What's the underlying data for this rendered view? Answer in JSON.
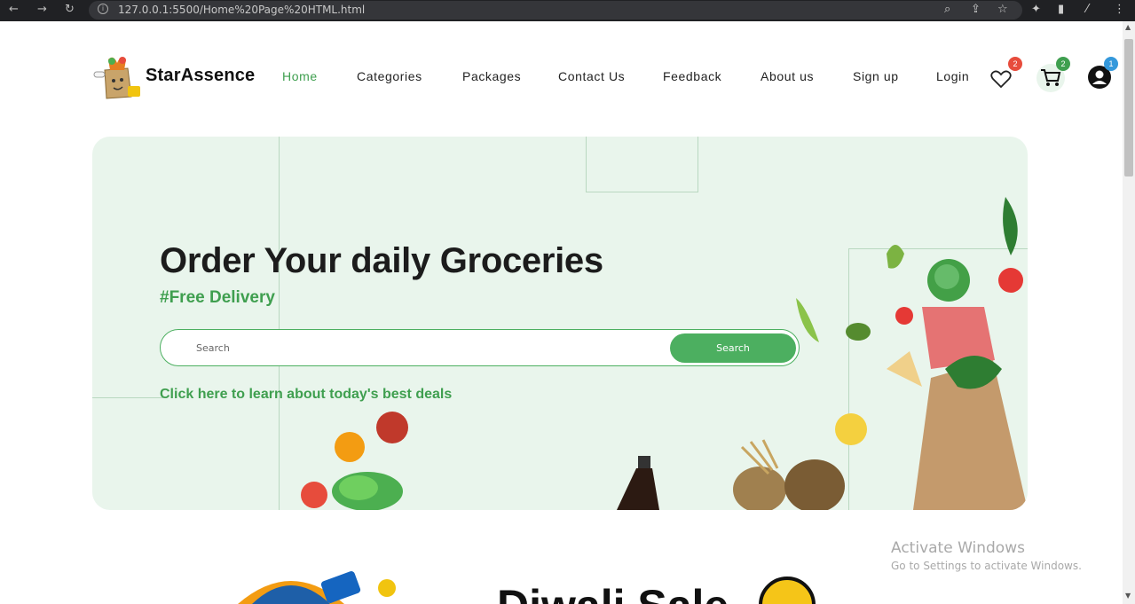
{
  "browser": {
    "url": "127.0.0.1:5500/Home%20Page%20HTML.html"
  },
  "header": {
    "brand": "StarAssence",
    "nav": [
      {
        "label": "Home",
        "active": true
      },
      {
        "label": "Categories",
        "active": false
      },
      {
        "label": "Packages",
        "active": false
      },
      {
        "label": "Contact Us",
        "active": false
      },
      {
        "label": "Feedback",
        "active": false
      },
      {
        "label": "About us",
        "active": false
      },
      {
        "label": "Sign up",
        "active": false
      },
      {
        "label": "Login",
        "active": false
      }
    ],
    "wishlist_count": "2",
    "cart_count": "2",
    "profile_count": "1",
    "icons": [
      "heart-icon",
      "cart-icon",
      "user-icon"
    ]
  },
  "hero": {
    "title": "Order Your daily Groceries",
    "subtitle": "#Free Delivery",
    "search_placeholder": "Search",
    "search_button": "Search",
    "deals_link": "Click here to learn about today's best deals"
  },
  "watermark": {
    "line1": "Activate Windows",
    "line2": "Go to Settings to activate Windows."
  },
  "promo": {
    "title": "Diwali Sale"
  },
  "colors": {
    "accent": "#3f9f4f",
    "hero_bg": "#e9f5ec",
    "badge_red": "#e74c3c",
    "badge_green": "#3f9f4f",
    "badge_blue": "#3498db"
  }
}
